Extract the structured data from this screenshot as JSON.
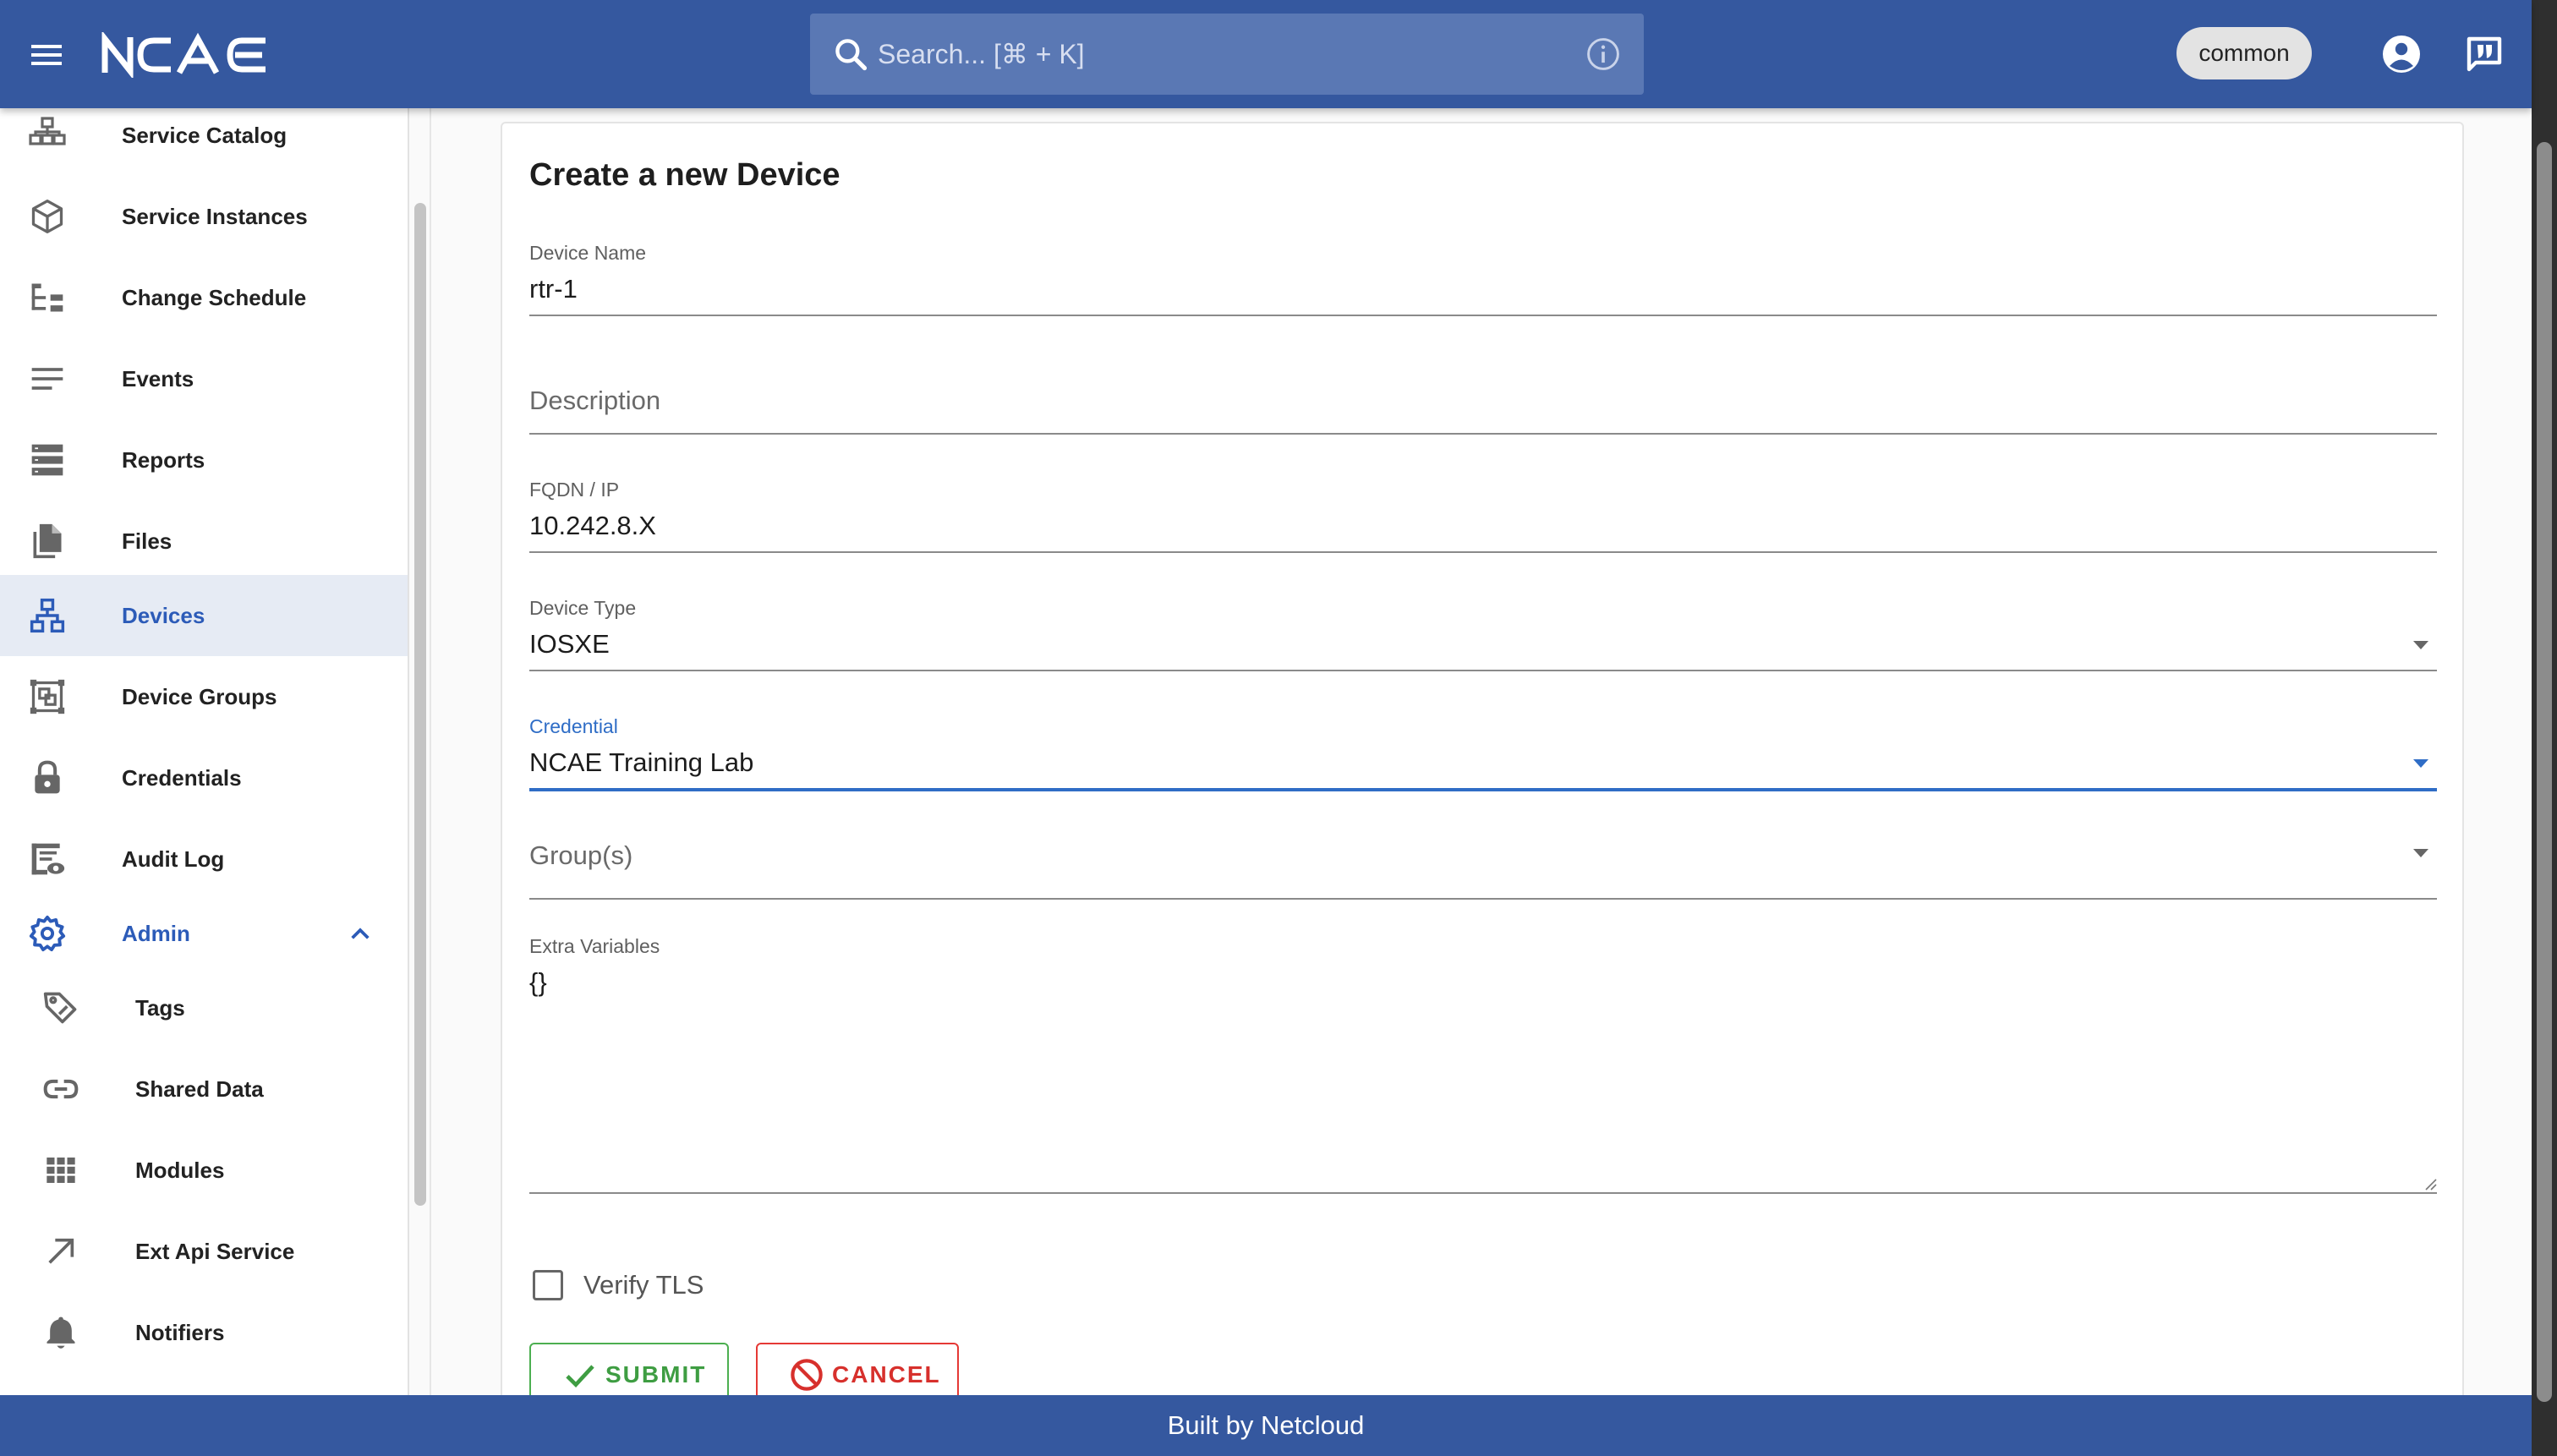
{
  "app": {
    "logo_text": "NCAE",
    "search_placeholder": "Search... [⌘ + K]",
    "tenant": "common"
  },
  "sidebar": {
    "items": [
      {
        "label": "Service Catalog",
        "icon": "service-catalog-icon"
      },
      {
        "label": "Service Instances",
        "icon": "cube-icon"
      },
      {
        "label": "Change Schedule",
        "icon": "schedule-tree-icon"
      },
      {
        "label": "Events",
        "icon": "lines-icon"
      },
      {
        "label": "Reports",
        "icon": "reports-icon"
      },
      {
        "label": "Files",
        "icon": "files-icon"
      },
      {
        "label": "Devices",
        "icon": "devices-network-icon",
        "active": true
      },
      {
        "label": "Device Groups",
        "icon": "device-groups-icon"
      },
      {
        "label": "Credentials",
        "icon": "lock-icon"
      },
      {
        "label": "Audit Log",
        "icon": "audit-log-icon"
      },
      {
        "label": "Admin",
        "icon": "gear-icon",
        "expanded": true
      }
    ],
    "admin_items": [
      {
        "label": "Tags",
        "icon": "tag-icon"
      },
      {
        "label": "Shared Data",
        "icon": "link-icon"
      },
      {
        "label": "Modules",
        "icon": "grid-icon"
      },
      {
        "label": "Ext Api Service",
        "icon": "arrow-diagonal-icon"
      },
      {
        "label": "Notifiers",
        "icon": "bell-icon"
      }
    ]
  },
  "form": {
    "title": "Create a new Device",
    "device_name": {
      "label": "Device Name",
      "value": "rtr-1"
    },
    "description": {
      "placeholder": "Description"
    },
    "fqdn": {
      "label": "FQDN / IP",
      "value": "10.242.8.X"
    },
    "device_type": {
      "label": "Device Type",
      "value": "IOSXE"
    },
    "credential": {
      "label": "Credential",
      "value": "NCAE Training Lab"
    },
    "groups": {
      "placeholder": "Group(s)"
    },
    "extra_vars": {
      "label": "Extra Variables",
      "value": "{}"
    },
    "verify_tls": {
      "label": "Verify TLS",
      "checked": false
    },
    "submit_label": "SUBMIT",
    "cancel_label": "CANCEL"
  },
  "colors": {
    "header": "#35589f",
    "active_nav": "#2c5bb8",
    "submit": "#4caf50",
    "cancel": "#e53935"
  },
  "footer": {
    "text": "Built by Netcloud"
  }
}
